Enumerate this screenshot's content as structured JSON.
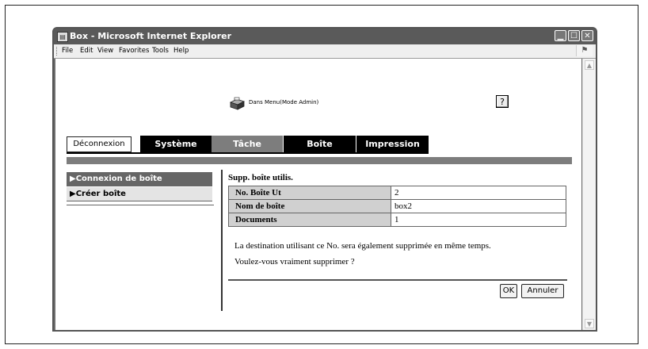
{
  "window": {
    "title": "Box - Microsoft Internet Explorer",
    "controls": [
      "minimize",
      "maximize",
      "close"
    ]
  },
  "menubar": {
    "items": [
      "File",
      "Edit",
      "View",
      "Favorites",
      "Tools",
      "Help"
    ]
  },
  "header": {
    "mode_text": "Dans Menu(Mode Admin)",
    "help_label": "?"
  },
  "nav": {
    "logout_label": "Déconnexion",
    "tabs": [
      {
        "label": "Système",
        "style": "dark"
      },
      {
        "label": "Tâche",
        "style": "grey"
      },
      {
        "label": "Boîte",
        "style": "dark"
      },
      {
        "label": "Impression",
        "style": "dark"
      }
    ]
  },
  "sidebar": {
    "items": [
      {
        "label": "▶Connexion de boîte",
        "active": true
      },
      {
        "label": "▶Créer boîte",
        "active": false
      }
    ]
  },
  "main": {
    "title": "Supp. boîte utilis.",
    "rows": [
      {
        "label": "No. Boîte Ut",
        "value": "2"
      },
      {
        "label": "Nom de boîte",
        "value": "box2"
      },
      {
        "label": "Documents",
        "value": "1"
      }
    ],
    "message_line1": "La destination utilisant ce No. sera également supprimée en même temps.",
    "message_line2": "Voulez-vous vraiment supprimer ?",
    "ok_label": "OK",
    "cancel_label": "Annuler"
  },
  "colors": {
    "title_bar": "#5a5a5a",
    "tab_dark": "#000000",
    "tab_grey": "#7d7d7d",
    "label_cell": "#d0d0d0"
  }
}
